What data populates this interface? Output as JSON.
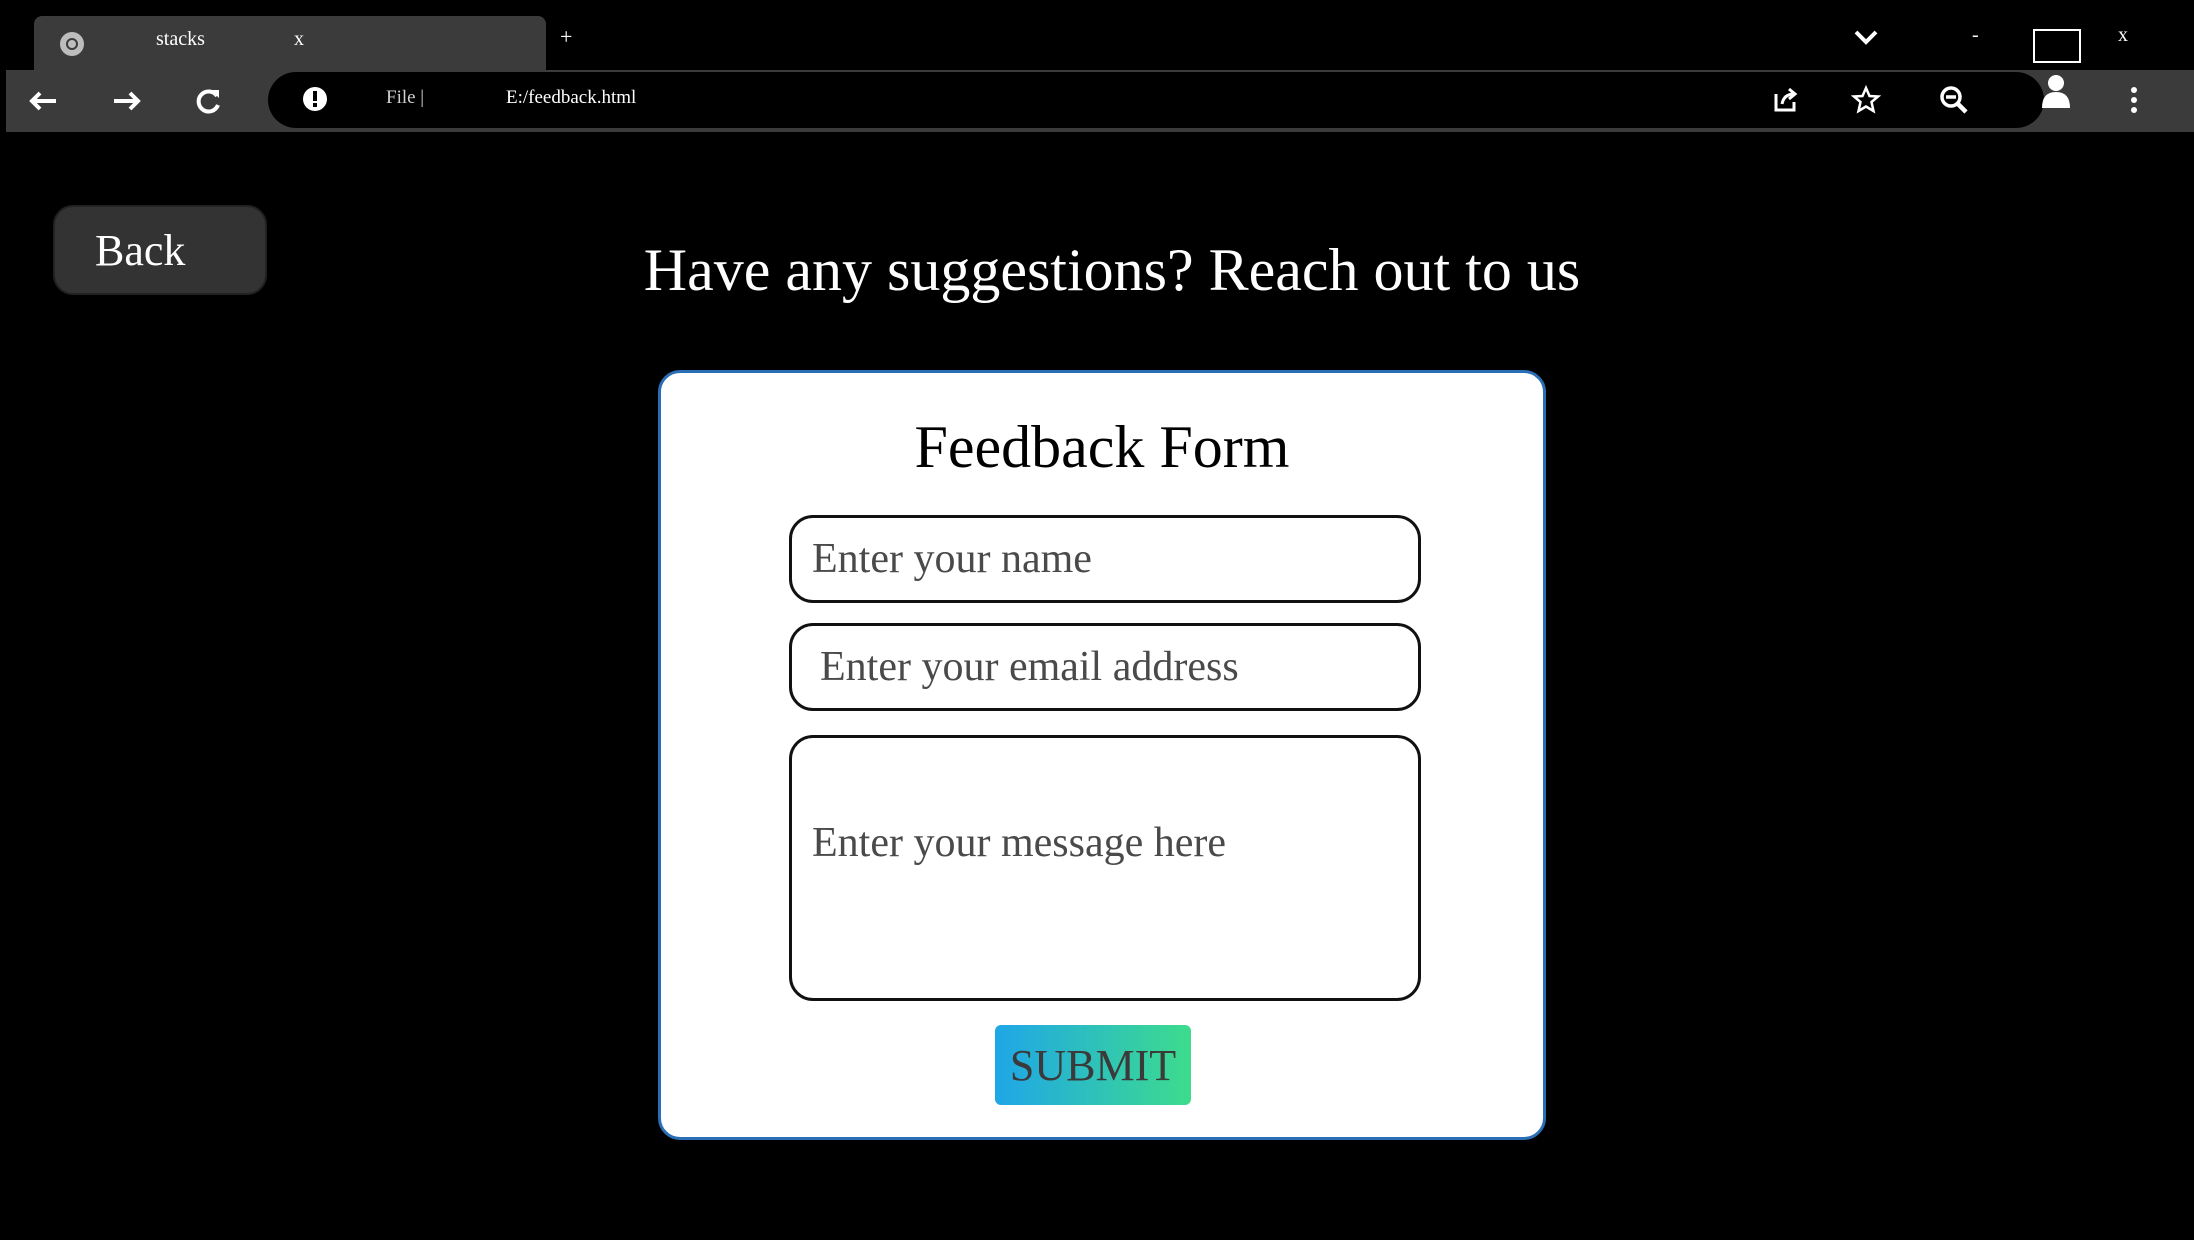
{
  "browser": {
    "tab": {
      "title": "stacks",
      "close": "x"
    },
    "new_tab": "+",
    "window_controls": {
      "tab_search": "tab-search",
      "minimize": "-",
      "maximize": "maximize",
      "close": "x"
    },
    "address": {
      "scheme": "File |",
      "url": "E:/feedback.html"
    },
    "icons": [
      "back-arrow-icon",
      "forward-arrow-icon",
      "reload-icon",
      "info-icon",
      "share-icon",
      "star-icon",
      "zoom-out-icon",
      "profile-icon",
      "kebab-menu-icon"
    ]
  },
  "page": {
    "back_label": "Back",
    "heading": "Have any suggestions? Reach out to us",
    "form": {
      "title": "Feedback Form",
      "name_placeholder": "Enter your name",
      "email_placeholder": "Enter your email address",
      "message_placeholder": "Enter your message here",
      "submit_label": "SUBMIT"
    }
  },
  "colors": {
    "page_background": "#000000",
    "chrome_background": "#3b3b3b",
    "card_border": "#2a6fb6",
    "submit_gradient_start": "#1fa6e8",
    "submit_gradient_end": "#3ddc8c"
  }
}
